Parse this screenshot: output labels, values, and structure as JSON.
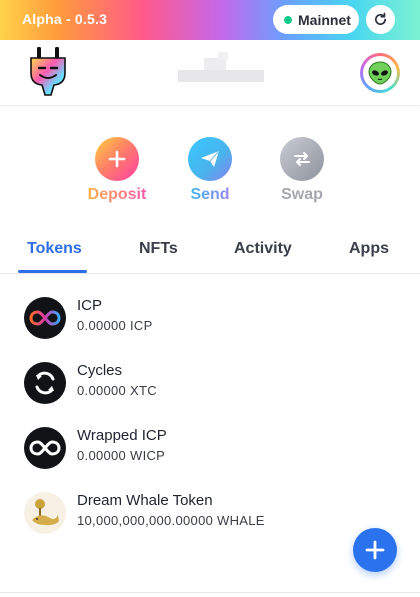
{
  "topbar": {
    "version": "Alpha - 0.5.3",
    "network": "Mainnet",
    "network_status_color": "#10c98a",
    "refresh_icon": "refresh-icon"
  },
  "header": {
    "logo_icon": "plug-logo-icon",
    "avatar_icon": "alien-avatar-icon"
  },
  "actions": [
    {
      "label": "Deposit",
      "icon": "plus-icon"
    },
    {
      "label": "Send",
      "icon": "paper-plane-icon"
    },
    {
      "label": "Swap",
      "icon": "swap-arrows-icon"
    }
  ],
  "tabs": [
    {
      "label": "Tokens",
      "active": true
    },
    {
      "label": "NFTs",
      "active": false
    },
    {
      "label": "Activity",
      "active": false
    },
    {
      "label": "Apps",
      "active": false
    }
  ],
  "tokens": [
    {
      "name": "ICP",
      "amount": "0.00000 ICP",
      "icon": "icp-infinity-icon"
    },
    {
      "name": "Cycles",
      "amount": "0.00000 XTC",
      "icon": "cycles-icon"
    },
    {
      "name": "Wrapped ICP",
      "amount": "0.00000 WICP",
      "icon": "wicp-infinity-icon"
    },
    {
      "name": "Dream Whale Token",
      "amount": "10,000,000,000.00000 WHALE",
      "icon": "whale-icon"
    }
  ],
  "fab_icon": "add-token-plus-icon",
  "colors": {
    "accent": "#2f6fe6",
    "fab": "#2b73ee"
  }
}
